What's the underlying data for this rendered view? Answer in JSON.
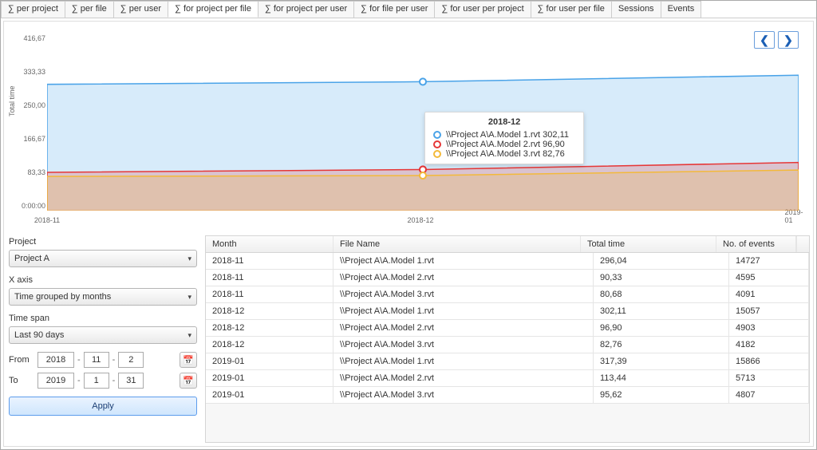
{
  "tabs": [
    {
      "label": "∑ per project",
      "active": false
    },
    {
      "label": "∑ per file",
      "active": false
    },
    {
      "label": "∑ per user",
      "active": false
    },
    {
      "label": "∑ for project per file",
      "active": true
    },
    {
      "label": "∑ for project per user",
      "active": false
    },
    {
      "label": "∑ for file per user",
      "active": false
    },
    {
      "label": "∑ for user per project",
      "active": false
    },
    {
      "label": "∑ for user per file",
      "active": false
    },
    {
      "label": "Sessions",
      "active": false
    },
    {
      "label": "Events",
      "active": false
    }
  ],
  "nav": {
    "prev_icon": "❮",
    "next_icon": "❯"
  },
  "chart_data": {
    "type": "area",
    "title": "",
    "xlabel": "",
    "ylabel": "Total time",
    "ylim": [
      0,
      416.67
    ],
    "yticks": [
      "0:00:00",
      "83,33",
      "166,67",
      "250,00",
      "333,33",
      "416,67"
    ],
    "categories": [
      "2018-11",
      "2018-12",
      "2019-01"
    ],
    "series": [
      {
        "name": "\\\\Project A\\A.Model 1.rvt",
        "color": "#4aa3e8",
        "values": [
          296.04,
          302.11,
          317.39
        ]
      },
      {
        "name": "\\\\Project A\\A.Model 2.rvt",
        "color": "#e63737",
        "values": [
          90.33,
          96.9,
          113.44
        ]
      },
      {
        "name": "\\\\Project A\\A.Model 3.rvt",
        "color": "#f3b93a",
        "values": [
          80.68,
          82.76,
          95.62
        ]
      }
    ]
  },
  "tooltip": {
    "title": "2018-12",
    "rows": [
      {
        "color": "#4aa3e8",
        "label": "\\\\Project A\\A.Model 1.rvt",
        "value": "302,11"
      },
      {
        "color": "#e63737",
        "label": "\\\\Project A\\A.Model 2.rvt",
        "value": "96,90"
      },
      {
        "color": "#f3b93a",
        "label": "\\\\Project A\\A.Model 3.rvt",
        "value": "82,76"
      }
    ]
  },
  "side": {
    "project_label": "Project",
    "project_value": "Project A",
    "xaxis_label": "X axis",
    "xaxis_value": "Time grouped by months",
    "timespan_label": "Time span",
    "timespan_value": "Last 90 days",
    "from_label": "From",
    "from_y": "2018",
    "from_m": "11",
    "from_d": "2",
    "to_label": "To",
    "to_y": "2019",
    "to_m": "1",
    "to_d": "31",
    "apply_label": "Apply",
    "calendar_icon": "📅"
  },
  "table": {
    "headers": {
      "month": "Month",
      "file": "File Name",
      "time": "Total time",
      "events": "No. of events"
    },
    "rows": [
      {
        "month": "2018-11",
        "file": "\\\\Project A\\A.Model 1.rvt",
        "time": "296,04",
        "events": "14727"
      },
      {
        "month": "2018-11",
        "file": "\\\\Project A\\A.Model 2.rvt",
        "time": "90,33",
        "events": "4595"
      },
      {
        "month": "2018-11",
        "file": "\\\\Project A\\A.Model 3.rvt",
        "time": "80,68",
        "events": "4091"
      },
      {
        "month": "2018-12",
        "file": "\\\\Project A\\A.Model 1.rvt",
        "time": "302,11",
        "events": "15057"
      },
      {
        "month": "2018-12",
        "file": "\\\\Project A\\A.Model 2.rvt",
        "time": "96,90",
        "events": "4903"
      },
      {
        "month": "2018-12",
        "file": "\\\\Project A\\A.Model 3.rvt",
        "time": "82,76",
        "events": "4182"
      },
      {
        "month": "2019-01",
        "file": "\\\\Project A\\A.Model 1.rvt",
        "time": "317,39",
        "events": "15866"
      },
      {
        "month": "2019-01",
        "file": "\\\\Project A\\A.Model 2.rvt",
        "time": "113,44",
        "events": "5713"
      },
      {
        "month": "2019-01",
        "file": "\\\\Project A\\A.Model 3.rvt",
        "time": "95,62",
        "events": "4807"
      }
    ]
  }
}
